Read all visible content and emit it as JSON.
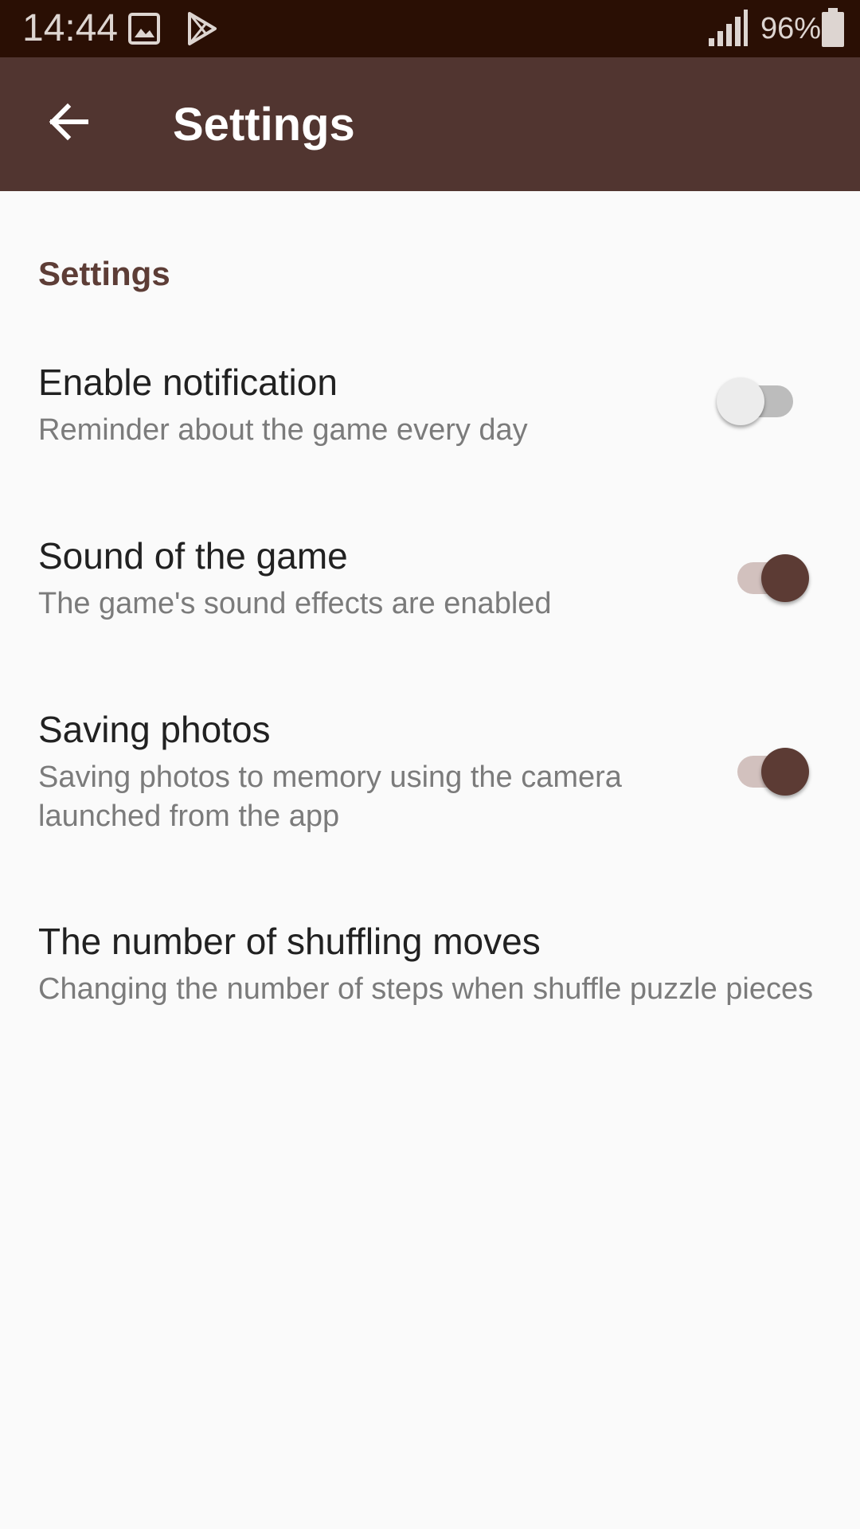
{
  "status_bar": {
    "time": "14:44",
    "battery_percent": "96%",
    "icons": [
      "photo-icon",
      "play-store-icon",
      "signal-icon",
      "battery-icon"
    ]
  },
  "app_bar": {
    "back_icon": "arrow-left-icon",
    "title": "Settings"
  },
  "content": {
    "section_header": "Settings",
    "preferences": [
      {
        "title": "Enable notification",
        "summary": "Reminder about the game every day",
        "switch_on": false
      },
      {
        "title": "Sound of the game",
        "summary": "The game's sound effects are enabled",
        "switch_on": true
      },
      {
        "title": "Saving photos",
        "summary": "Saving photos to memory using the camera launched from the app",
        "switch_on": true
      },
      {
        "title": "The number of shuffling moves",
        "summary": "Changing the number of steps when shuffle puzzle pieces"
      }
    ]
  },
  "colors": {
    "status_bar": "#2a0f04",
    "app_bar": "#513530",
    "accent": "#5c3b34",
    "background": "#fafafa"
  }
}
